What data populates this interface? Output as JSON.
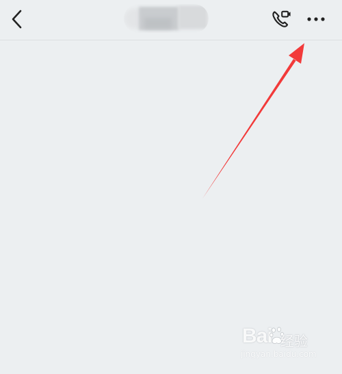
{
  "header": {
    "title": "",
    "back_icon": "chevron-left-icon",
    "call_icon": "voice-video-call-icon",
    "more_icon": "ellipsis-icon"
  },
  "annotation": {
    "arrow_color": "#f23a3a",
    "points_to": "more-options-button"
  },
  "watermark": {
    "brand": "Bai",
    "brand_mark": "paw-icon",
    "brand_suffix": "经验",
    "url": "jingyan.baidu.com"
  },
  "colors": {
    "background": "#eceff1",
    "icon": "#222222"
  }
}
